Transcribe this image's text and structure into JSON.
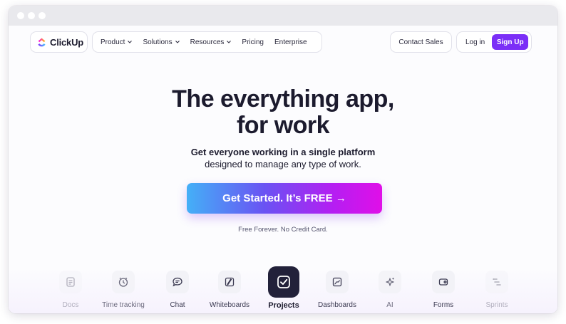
{
  "brand": {
    "name": "ClickUp"
  },
  "nav": {
    "menu": [
      {
        "label": "Product",
        "dropdown": true
      },
      {
        "label": "Solutions",
        "dropdown": true
      },
      {
        "label": "Resources",
        "dropdown": true
      },
      {
        "label": "Pricing",
        "dropdown": false
      },
      {
        "label": "Enterprise",
        "dropdown": false
      }
    ],
    "contact_label": "Contact Sales",
    "login_label": "Log in",
    "signup_label": "Sign Up"
  },
  "hero": {
    "headline_line1": "The everything app,",
    "headline_line2": "for work",
    "sub_line1": "Get everyone working in a single platform",
    "sub_line2": "designed to manage any type of work.",
    "cta_label": "Get Started. It’s FREE →",
    "note": "Free Forever. No Credit Card."
  },
  "features": [
    {
      "label": "Docs",
      "icon": "doc-icon"
    },
    {
      "label": "Time tracking",
      "icon": "clock-icon"
    },
    {
      "label": "Chat",
      "icon": "chat-icon"
    },
    {
      "label": "Whiteboards",
      "icon": "whiteboard-icon"
    },
    {
      "label": "Projects",
      "icon": "checkbox-icon",
      "selected": true
    },
    {
      "label": "Dashboards",
      "icon": "chart-icon"
    },
    {
      "label": "AI",
      "icon": "sparkle-icon"
    },
    {
      "label": "Forms",
      "icon": "form-icon"
    },
    {
      "label": "Sprints",
      "icon": "sprint-icon"
    }
  ],
  "colors": {
    "accent": "#7b2ff7",
    "cta_gradient": [
      "#44b0f7",
      "#6a52f3",
      "#b51ef2",
      "#e00fe8"
    ],
    "text_dark": "#1c1b2e",
    "active_tile": "#22213a"
  }
}
